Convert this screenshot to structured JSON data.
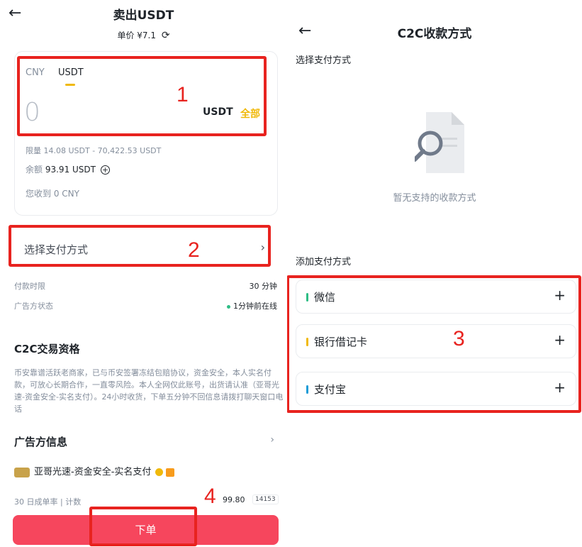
{
  "left": {
    "title": "卖出USDT",
    "price_label": "单价",
    "price_value": "¥7.1",
    "tabs": [
      "CNY",
      "USDT"
    ],
    "amount_value": "0",
    "amount_unit": "USDT",
    "all_label": "全部",
    "limit_label": "限量",
    "limit_value": "14.08 USDT - 70,422.53 USDT",
    "balance_label": "余额",
    "balance_value": "93.91 USDT",
    "receive_label": "您收到",
    "receive_value": "0 CNY",
    "select_payment_label": "选择支付方式",
    "payment_time_label": "付款时限",
    "payment_time_value": "30 分钟",
    "advertiser_status_label": "广告方状态",
    "advertiser_status_value": "1分钟前在线",
    "c2c_title": "C2C交易资格",
    "description": "币安靠谱活跃老商家，已与币安签署冻结包赔协议，资金安全，本人实名付款，可放心长期合作，一直零风险。本人全网仅此账号，出货请认准（亚哥光速-资金安全-实名支付）。24小时收货，下单五分钟不回信息请拨打聊天窗口电话",
    "advertiser_info_title": "广告方信息",
    "merchant_name": "亚哥光速-资金安全-实名支付",
    "stats_label": "30 日成单率 | 计数",
    "stats_value": "99.80",
    "stats_count": "14153",
    "order_button": "下单"
  },
  "right": {
    "title": "C2C收款方式",
    "select_label": "选择支付方式",
    "empty_text": "暂无支持的收款方式",
    "add_label": "添加支付方式",
    "methods": [
      {
        "name": "微信",
        "color": "#2ebd85"
      },
      {
        "name": "银行借记卡",
        "color": "#f0b90b"
      },
      {
        "name": "支付宝",
        "color": "#1e9cd7"
      }
    ]
  },
  "annotations": [
    "1",
    "2",
    "3",
    "4"
  ],
  "colors": {
    "accent": "#f0b90b",
    "sell_button": "#f6465d",
    "annotation": "#e8231f"
  }
}
